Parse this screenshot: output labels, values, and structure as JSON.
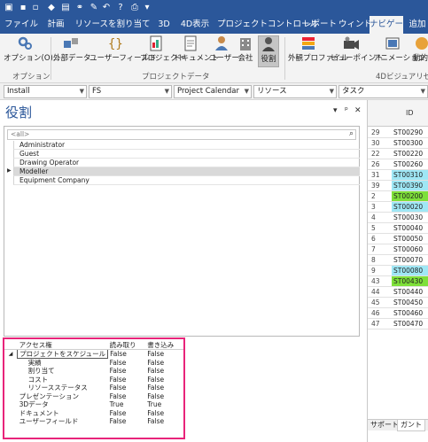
{
  "ribbon_tabs": [
    {
      "label": "ファイル"
    },
    {
      "label": "計画"
    },
    {
      "label": "リソースを割り当て"
    },
    {
      "label": "3D"
    },
    {
      "label": "4D表示"
    },
    {
      "label": "プロジェクトコントロール"
    },
    {
      "label": "レポート"
    },
    {
      "label": "ウィンドウ"
    },
    {
      "label": "ナビゲータ"
    },
    {
      "label": "追加"
    }
  ],
  "ribbon_buttons": [
    {
      "label": "オプション(O)..."
    },
    {
      "label": "外部データ"
    },
    {
      "label": "ユーザーフィールド"
    },
    {
      "label": "プロジェクト"
    },
    {
      "label": "ドキュメント"
    },
    {
      "label": "ユーザー"
    },
    {
      "label": "会社"
    },
    {
      "label": "役割"
    },
    {
      "label": "外観プロファイル"
    },
    {
      "label": "ビューポイント"
    },
    {
      "label": "アニメーション"
    },
    {
      "label": "動的"
    }
  ],
  "ribbon_groups": {
    "options": "オプション",
    "project_data": "プロジェクトデータ",
    "visual_4d": "4Dビジュアリゼ"
  },
  "combos": [
    {
      "value": "Install"
    },
    {
      "value": "FS"
    },
    {
      "value": "Project Calendar"
    },
    {
      "value": "リソース"
    },
    {
      "value": "タスク"
    }
  ],
  "panel": {
    "title": "役割",
    "controls": [
      "▾",
      "ᵖ",
      "✕"
    ],
    "filter_placeholder": "<all>"
  },
  "roles": [
    "Administrator",
    "Guest",
    "Drawing Operator",
    "Modeller",
    "Equipment Company"
  ],
  "access_table": {
    "headers": [
      "アクセス権",
      "読み取り",
      "書き込み"
    ],
    "rows": [
      {
        "name": "プロジェクトをスケジュール",
        "read": "False",
        "write": "False"
      },
      {
        "name": "実績",
        "read": "False",
        "write": "False"
      },
      {
        "name": "割り当て",
        "read": "False",
        "write": "False"
      },
      {
        "name": "コスト",
        "read": "False",
        "write": "False"
      },
      {
        "name": "リソースステータス",
        "read": "False",
        "write": "False"
      },
      {
        "name": "プレゼンテーション",
        "read": "False",
        "write": "False"
      },
      {
        "name": "3Dデータ",
        "read": "True",
        "write": "True"
      },
      {
        "name": "ドキュメント",
        "read": "False",
        "write": "False"
      },
      {
        "name": "ユーザーフィールド",
        "read": "False",
        "write": "False"
      }
    ]
  },
  "grid": {
    "header": "ID",
    "rows": [
      {
        "n": "29",
        "id": "ST00290",
        "color": ""
      },
      {
        "n": "30",
        "id": "ST00300",
        "color": ""
      },
      {
        "n": "22",
        "id": "ST00220",
        "color": ""
      },
      {
        "n": "26",
        "id": "ST00260",
        "color": ""
      },
      {
        "n": "31",
        "id": "ST00310",
        "color": "#9fe7f5"
      },
      {
        "n": "39",
        "id": "ST00390",
        "color": "#9fe7f5"
      },
      {
        "n": "2",
        "id": "ST00200",
        "color": "#7ee03a"
      },
      {
        "n": "3",
        "id": "ST00020",
        "color": "#9fe7f5"
      },
      {
        "n": "4",
        "id": "ST00030",
        "color": ""
      },
      {
        "n": "5",
        "id": "ST00040",
        "color": ""
      },
      {
        "n": "6",
        "id": "ST00050",
        "color": ""
      },
      {
        "n": "7",
        "id": "ST00060",
        "color": ""
      },
      {
        "n": "8",
        "id": "ST00070",
        "color": ""
      },
      {
        "n": "9",
        "id": "ST00080",
        "color": "#9fe7f5"
      },
      {
        "n": "43",
        "id": "ST00430",
        "color": "#7ee03a"
      },
      {
        "n": "44",
        "id": "ST00440",
        "color": ""
      },
      {
        "n": "45",
        "id": "ST00450",
        "color": ""
      },
      {
        "n": "46",
        "id": "ST00460",
        "color": ""
      },
      {
        "n": "47",
        "id": "ST00470",
        "color": ""
      }
    ],
    "tabs": [
      "サポート",
      "ガント"
    ]
  },
  "colors": {
    "ribbon_blue": "#2b579a",
    "highlight_border": "#e8247a"
  }
}
